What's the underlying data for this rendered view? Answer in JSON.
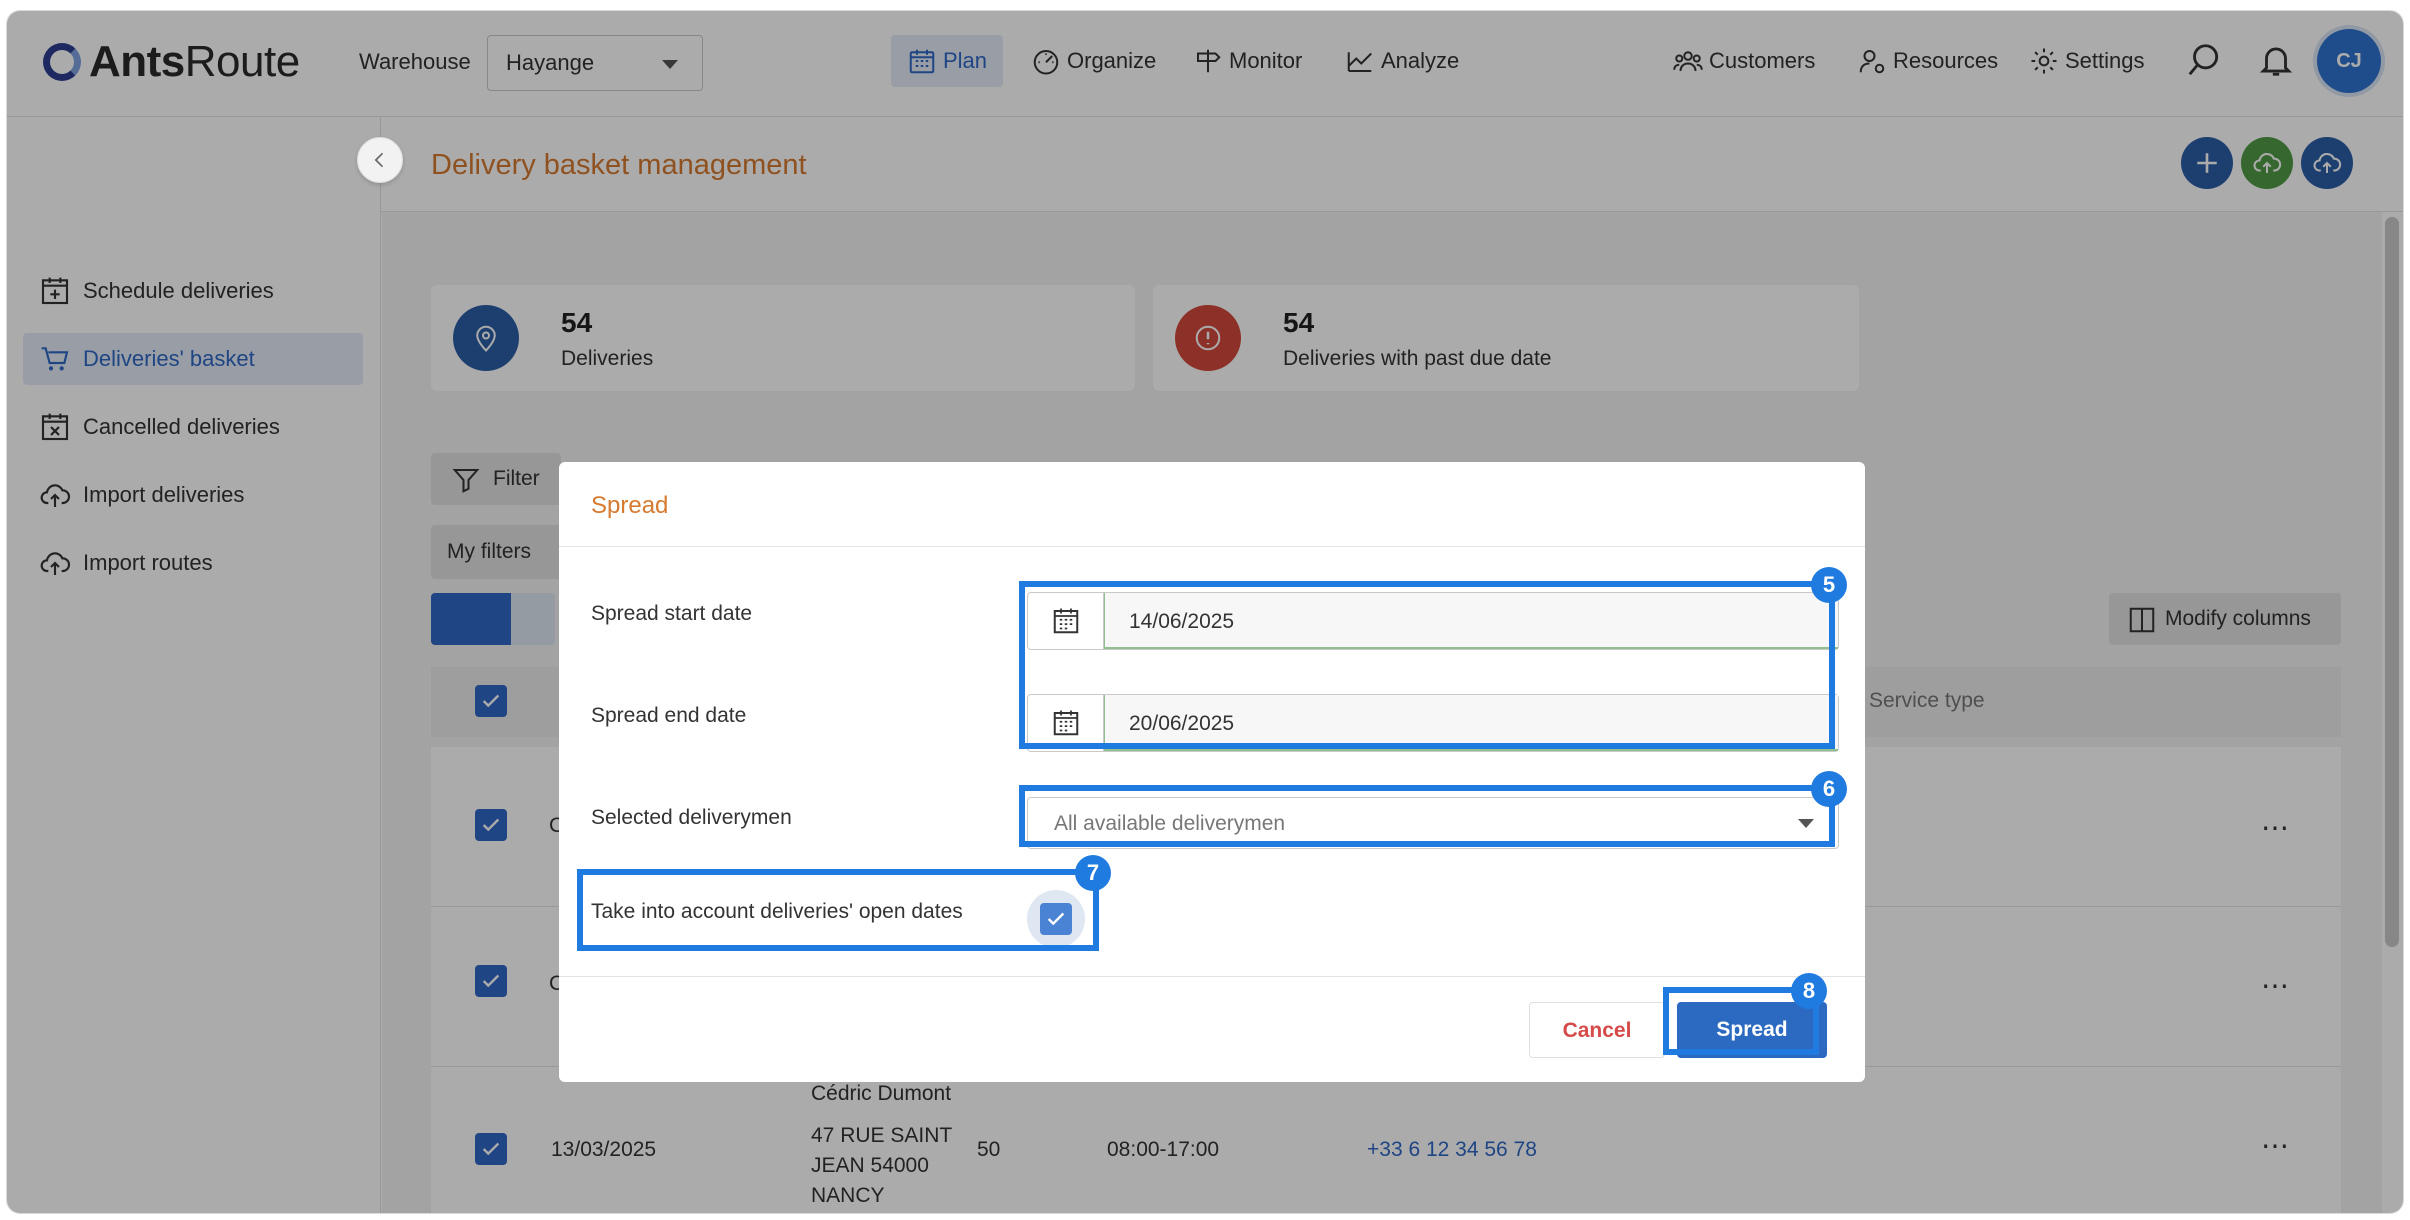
{
  "app": {
    "logo_bold": "Ants",
    "logo_light": "Route",
    "warehouse_label": "Warehouse",
    "warehouse_value": "Hayange",
    "avatar_initials": "CJ"
  },
  "nav": {
    "plan": "Plan",
    "organize": "Organize",
    "monitor": "Monitor",
    "analyze": "Analyze",
    "customers": "Customers",
    "resources": "Resources",
    "settings": "Settings"
  },
  "sidebar": {
    "items": [
      {
        "label": "Schedule deliveries",
        "icon": "calendar-add-icon"
      },
      {
        "label": "Deliveries' basket",
        "icon": "basket-icon"
      },
      {
        "label": "Cancelled deliveries",
        "icon": "calendar-cancel-icon"
      },
      {
        "label": "Import deliveries",
        "icon": "cloud-upload-icon"
      },
      {
        "label": "Import routes",
        "icon": "cloud-upload-icon"
      }
    ],
    "active_index": 1
  },
  "page": {
    "title": "Delivery basket management"
  },
  "stats": [
    {
      "value": "54",
      "label": "Deliveries",
      "color": "#2c5ea8"
    },
    {
      "value": "54",
      "label": "Deliveries with past due date",
      "color": "#d24a3c"
    }
  ],
  "toolbar": {
    "filter_label": "Filter",
    "my_filters_label": "My filters",
    "modify_columns_label": "Modify columns"
  },
  "table": {
    "header_service_type": "Service type",
    "visible_row": {
      "date": "13/03/2025",
      "name": "Cédric Dumont",
      "address_line1": "47 RUE SAINT",
      "address_line2": "JEAN 54000",
      "address_line3": "NANCY",
      "value": "50",
      "hours": "08:00-17:00",
      "phone": "+33 6 12 34 56 78"
    },
    "partial_cells": [
      "C",
      "C"
    ]
  },
  "modal": {
    "title": "Spread",
    "start_date_label": "Spread start date",
    "start_date_value": "14/06/2025",
    "end_date_label": "Spread end date",
    "end_date_value": "20/06/2025",
    "deliverymen_label": "Selected deliverymen",
    "deliverymen_value": "All available deliverymen",
    "open_dates_label": "Take into account deliveries' open dates",
    "open_dates_checked": true,
    "cancel_label": "Cancel",
    "spread_label": "Spread"
  },
  "annotations": {
    "badge_dates": "5",
    "badge_deliverymen": "6",
    "badge_open_dates": "7",
    "badge_spread": "8",
    "color": "#1f7be0"
  },
  "colors": {
    "primary": "#2f67c5",
    "title_orange": "#d67a2f",
    "danger": "#d64a4a"
  }
}
